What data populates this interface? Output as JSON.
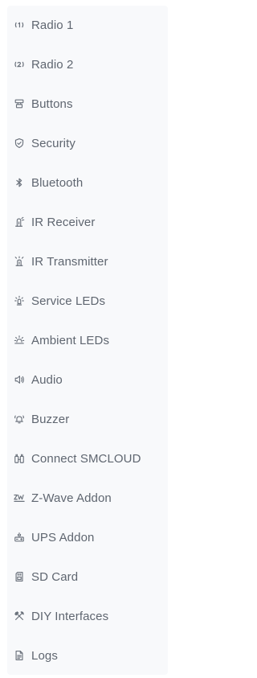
{
  "sidebar": {
    "items": [
      {
        "label": "Radio 1",
        "icon": "radio-signal-1-icon"
      },
      {
        "label": "Radio 2",
        "icon": "radio-signal-2-icon"
      },
      {
        "label": "Buttons",
        "icon": "buttons-icon"
      },
      {
        "label": "Security",
        "icon": "shield-icon"
      },
      {
        "label": "Bluetooth",
        "icon": "bluetooth-icon"
      },
      {
        "label": "IR Receiver",
        "icon": "ir-receiver-icon"
      },
      {
        "label": "IR Transmitter",
        "icon": "ir-transmitter-icon"
      },
      {
        "label": "Service LEDs",
        "icon": "led-bulb-icon"
      },
      {
        "label": "Ambient LEDs",
        "icon": "ambient-light-icon"
      },
      {
        "label": "Audio",
        "icon": "speaker-icon"
      },
      {
        "label": "Buzzer",
        "icon": "bell-ring-icon"
      },
      {
        "label": "Connect SMCLOUD",
        "icon": "cloud-connect-icon"
      },
      {
        "label": "Z-Wave Addon",
        "icon": "zwave-icon"
      },
      {
        "label": "UPS Addon",
        "icon": "battery-plug-icon"
      },
      {
        "label": "SD Card",
        "icon": "sd-card-icon"
      },
      {
        "label": "DIY Interfaces",
        "icon": "tools-icon"
      },
      {
        "label": "Logs",
        "icon": "document-icon"
      }
    ]
  },
  "colors": {
    "sidebar_background": "#f8f9fb",
    "text": "#5f6670",
    "icon": "#6b727c"
  }
}
